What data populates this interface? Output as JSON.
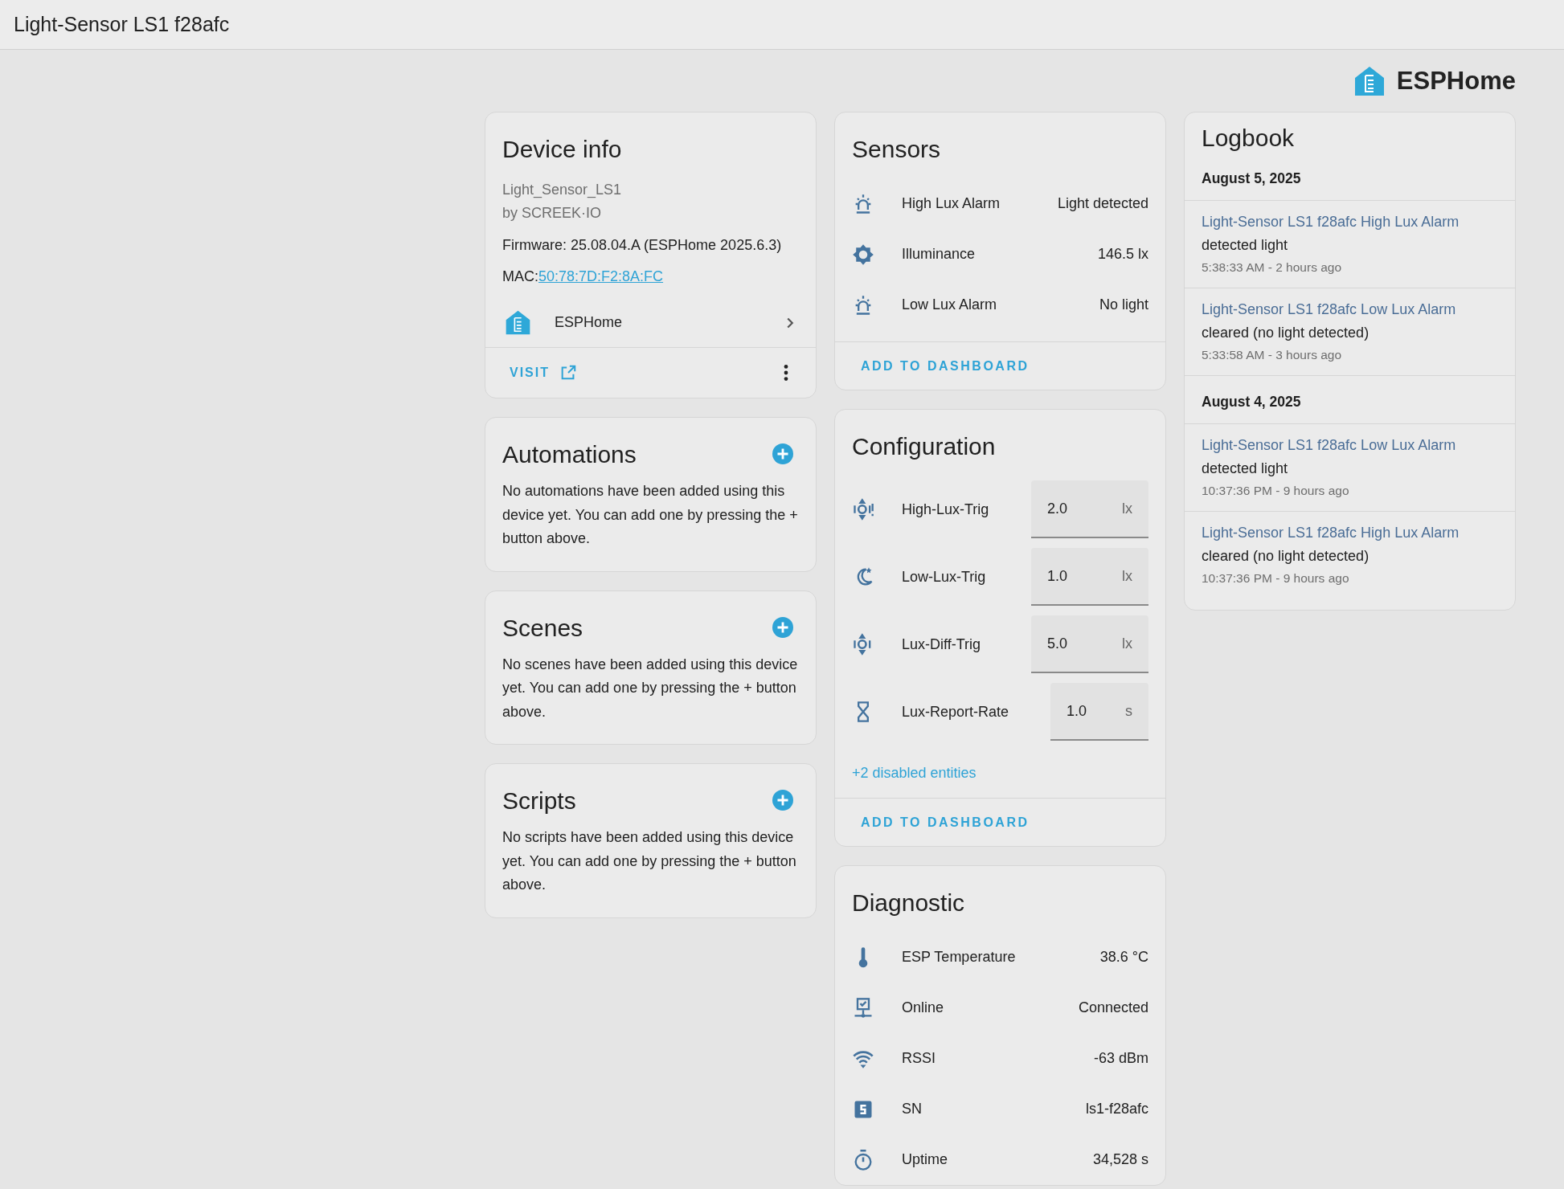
{
  "window": {
    "title": "Light-Sensor LS1 f28afc"
  },
  "brand": {
    "name": "ESPHome"
  },
  "device_info": {
    "title": "Device info",
    "model": "Light_Sensor_LS1",
    "manufacturer": "by SCREEK·IO",
    "firmware": "Firmware: 25.08.04.A (ESPHome 2025.6.3)",
    "mac_label": "MAC:",
    "mac": "50:78:7D:F2:8A:FC",
    "integration": "ESPHome",
    "visit": "VISIT"
  },
  "sections": [
    {
      "title": "Automations",
      "text": "No automations have been added using this device yet. You can add one by pressing the + button above."
    },
    {
      "title": "Scenes",
      "text": "No scenes have been added using this device yet. You can add one by pressing the + button above."
    },
    {
      "title": "Scripts",
      "text": "No scripts have been added using this device yet. You can add one by pressing the + button above."
    }
  ],
  "sensors": {
    "title": "Sensors",
    "rows": [
      {
        "name": "High Lux Alarm",
        "value": "Light detected"
      },
      {
        "name": "Illuminance",
        "value": "146.5 lx"
      },
      {
        "name": "Low Lux Alarm",
        "value": "No light"
      }
    ],
    "action": "ADD TO DASHBOARD"
  },
  "configuration": {
    "title": "Configuration",
    "rows": [
      {
        "name": "High-Lux-Trig",
        "value": "2.0",
        "unit": "lx"
      },
      {
        "name": "Low-Lux-Trig",
        "value": "1.0",
        "unit": "lx"
      },
      {
        "name": "Lux-Diff-Trig",
        "value": "5.0",
        "unit": "lx"
      },
      {
        "name": "Lux-Report-Rate",
        "value": "1.0",
        "unit": "s"
      }
    ],
    "disabled_link": "+2 disabled entities",
    "action": "ADD TO DASHBOARD"
  },
  "diagnostic": {
    "title": "Diagnostic",
    "rows": [
      {
        "name": "ESP Temperature",
        "value": "38.6 °C"
      },
      {
        "name": "Online",
        "value": "Connected"
      },
      {
        "name": "RSSI",
        "value": "-63 dBm"
      },
      {
        "name": "SN",
        "value": "ls1-f28afc"
      },
      {
        "name": "Uptime",
        "value": "34,528 s"
      }
    ]
  },
  "logbook": {
    "title": "Logbook",
    "days": [
      {
        "date": "August 5, 2025",
        "entries": [
          {
            "entity": "Light-Sensor LS1 f28afc High Lux Alarm",
            "message": "detected light",
            "time": "5:38:33 AM - 2 hours ago"
          },
          {
            "entity": "Light-Sensor LS1 f28afc Low Lux Alarm",
            "message": "cleared (no light detected)",
            "time": "5:33:58 AM - 3 hours ago"
          }
        ]
      },
      {
        "date": "August 4, 2025",
        "entries": [
          {
            "entity": "Light-Sensor LS1 f28afc Low Lux Alarm",
            "message": "detected light",
            "time": "10:37:36 PM - 9 hours ago"
          },
          {
            "entity": "Light-Sensor LS1 f28afc High Lux Alarm",
            "message": "cleared (no light detected)",
            "time": "10:37:36 PM - 9 hours ago"
          }
        ]
      }
    ]
  }
}
